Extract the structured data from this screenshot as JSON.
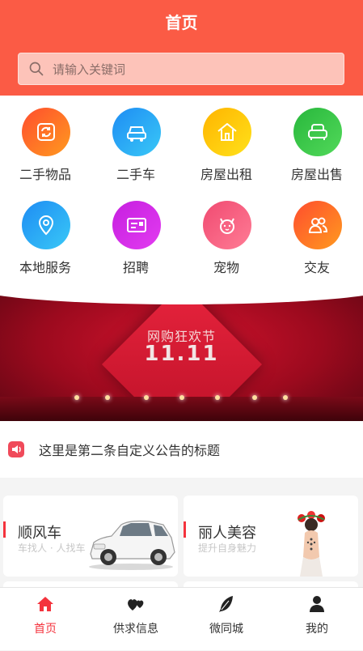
{
  "header": {
    "title": "首页"
  },
  "search": {
    "placeholder": "请输入关键词"
  },
  "categories": [
    {
      "label": "二手物品",
      "icon": "refresh-icon",
      "color_from": "#ff4d2e",
      "color_to": "#ff9a1f"
    },
    {
      "label": "二手车",
      "icon": "car-icon",
      "color_from": "#1e8cf4",
      "color_to": "#39c8f6"
    },
    {
      "label": "房屋出租",
      "icon": "house-icon",
      "color_from": "#ffb400",
      "color_to": "#ffe11a"
    },
    {
      "label": "房屋出售",
      "icon": "sofa-icon",
      "color_from": "#28b73c",
      "color_to": "#52d95a"
    },
    {
      "label": "本地服务",
      "icon": "location-icon",
      "color_from": "#1e8cf4",
      "color_to": "#39c8f6"
    },
    {
      "label": "招聘",
      "icon": "card-icon",
      "color_from": "#c61fe0",
      "color_to": "#e23cf0"
    },
    {
      "label": "宠物",
      "icon": "dog-icon",
      "color_from": "#f04a71",
      "color_to": "#ff7c95"
    },
    {
      "label": "交友",
      "icon": "friends-icon",
      "color_from": "#ff4d2e",
      "color_to": "#ff9a1f"
    }
  ],
  "banner": {
    "line1": "网购狂欢节",
    "line2": "11.11"
  },
  "notice": {
    "text": "这里是第二条自定义公告的标题",
    "icon": "speaker-icon"
  },
  "cards": [
    {
      "title": "顺风车",
      "subtitle": "车找人 · 人找车",
      "image": "white-suv-image"
    },
    {
      "title": "丽人美容",
      "subtitle": "提升自身魅力",
      "image": "beauty-model-image"
    }
  ],
  "tabbar": [
    {
      "label": "首页",
      "icon": "home-icon",
      "active": true
    },
    {
      "label": "供求信息",
      "icon": "hearts-icon",
      "active": false
    },
    {
      "label": "微同城",
      "icon": "feather-icon",
      "active": false
    },
    {
      "label": "我的",
      "icon": "user-icon",
      "active": false
    }
  ],
  "colors": {
    "brand": "#fb5b45",
    "accent": "#f4333d"
  }
}
